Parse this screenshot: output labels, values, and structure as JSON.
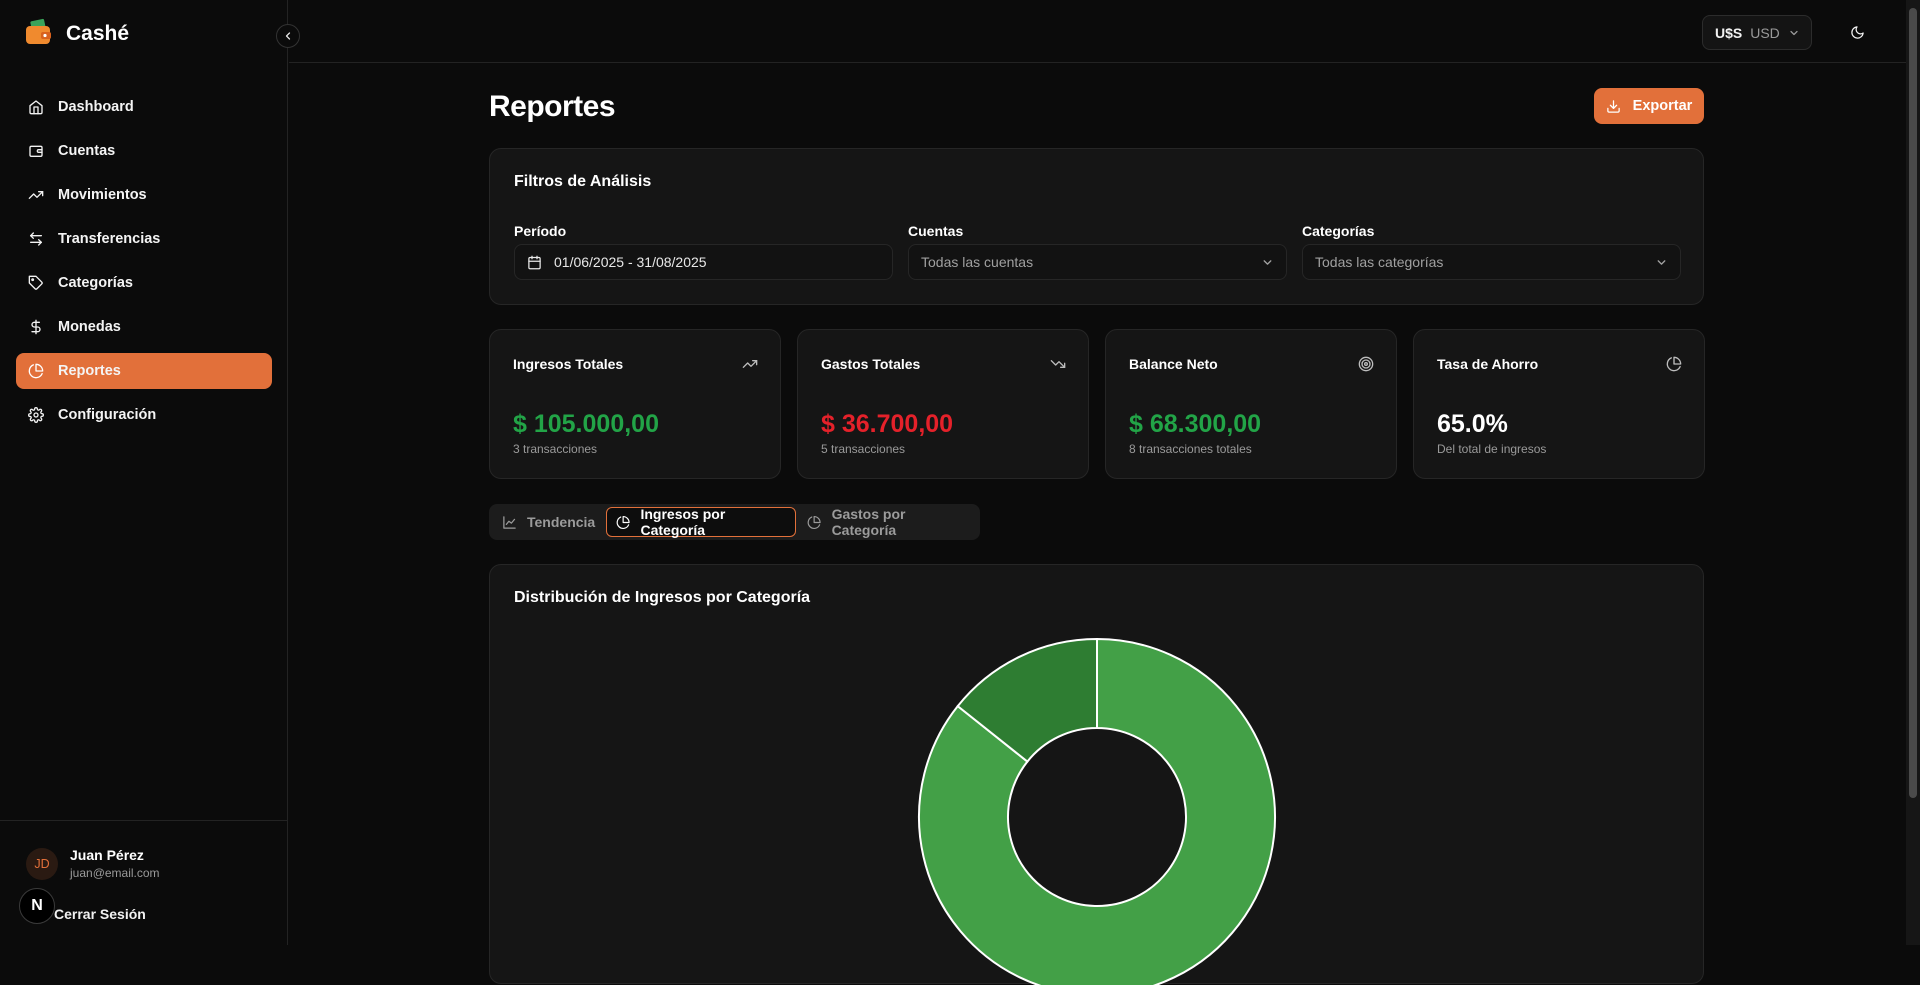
{
  "app": {
    "name": "Cashé"
  },
  "sidebar": {
    "items": [
      {
        "label": "Dashboard",
        "icon": "home-icon"
      },
      {
        "label": "Cuentas",
        "icon": "wallet-icon"
      },
      {
        "label": "Movimientos",
        "icon": "trending-up-icon"
      },
      {
        "label": "Transferencias",
        "icon": "arrows-left-right-icon"
      },
      {
        "label": "Categorías",
        "icon": "tag-icon"
      },
      {
        "label": "Monedas",
        "icon": "dollar-icon"
      },
      {
        "label": "Reportes",
        "icon": "pie-chart-icon",
        "active": true
      },
      {
        "label": "Configuración",
        "icon": "gear-icon"
      }
    ],
    "user": {
      "initials": "JD",
      "name": "Juan Pérez",
      "email": "juan@email.com"
    },
    "logout_label": "Cerrar Sesión",
    "dev_badge": "N"
  },
  "header": {
    "currency_symbol": "U$S",
    "currency_code": "USD"
  },
  "page": {
    "title": "Reportes",
    "export_label": "Exportar"
  },
  "filters": {
    "title": "Filtros de Análisis",
    "period": {
      "label": "Período",
      "value": "01/06/2025 - 31/08/2025"
    },
    "accounts": {
      "label": "Cuentas",
      "value": "Todas las cuentas"
    },
    "categories": {
      "label": "Categorías",
      "value": "Todas las categorías"
    }
  },
  "stats": [
    {
      "title": "Ingresos Totales",
      "value": "$ 105.000,00",
      "sub": "3 transacciones",
      "color": "#22a447",
      "icon": "trending-up-icon"
    },
    {
      "title": "Gastos Totales",
      "value": "$ 36.700,00",
      "sub": "5 transacciones",
      "color": "#e5212a",
      "icon": "trending-down-icon"
    },
    {
      "title": "Balance Neto",
      "value": "$ 68.300,00",
      "sub": "8 transacciones totales",
      "color": "#22a447",
      "icon": "target-icon"
    },
    {
      "title": "Tasa de Ahorro",
      "value": "65.0%",
      "sub": "Del total de ingresos",
      "color": "#ffffff",
      "icon": "pie-chart-icon"
    }
  ],
  "tabs": [
    {
      "label": "Tendencia",
      "icon": "line-chart-icon"
    },
    {
      "label": "Ingresos por Categoría",
      "icon": "pie-chart-icon",
      "active": true
    },
    {
      "label": "Gastos por Categoría",
      "icon": "pie-chart-icon"
    }
  ],
  "chart_data": {
    "type": "pie",
    "title": "Distribución de Ingresos por Categoría",
    "donut": true,
    "slices": [
      {
        "value": 0.857,
        "color": "#43a047"
      },
      {
        "value": 0.143,
        "color": "#2e7d32"
      }
    ]
  },
  "colors": {
    "accent": "#e2703a",
    "income": "#22a447",
    "expense": "#e5212a"
  }
}
